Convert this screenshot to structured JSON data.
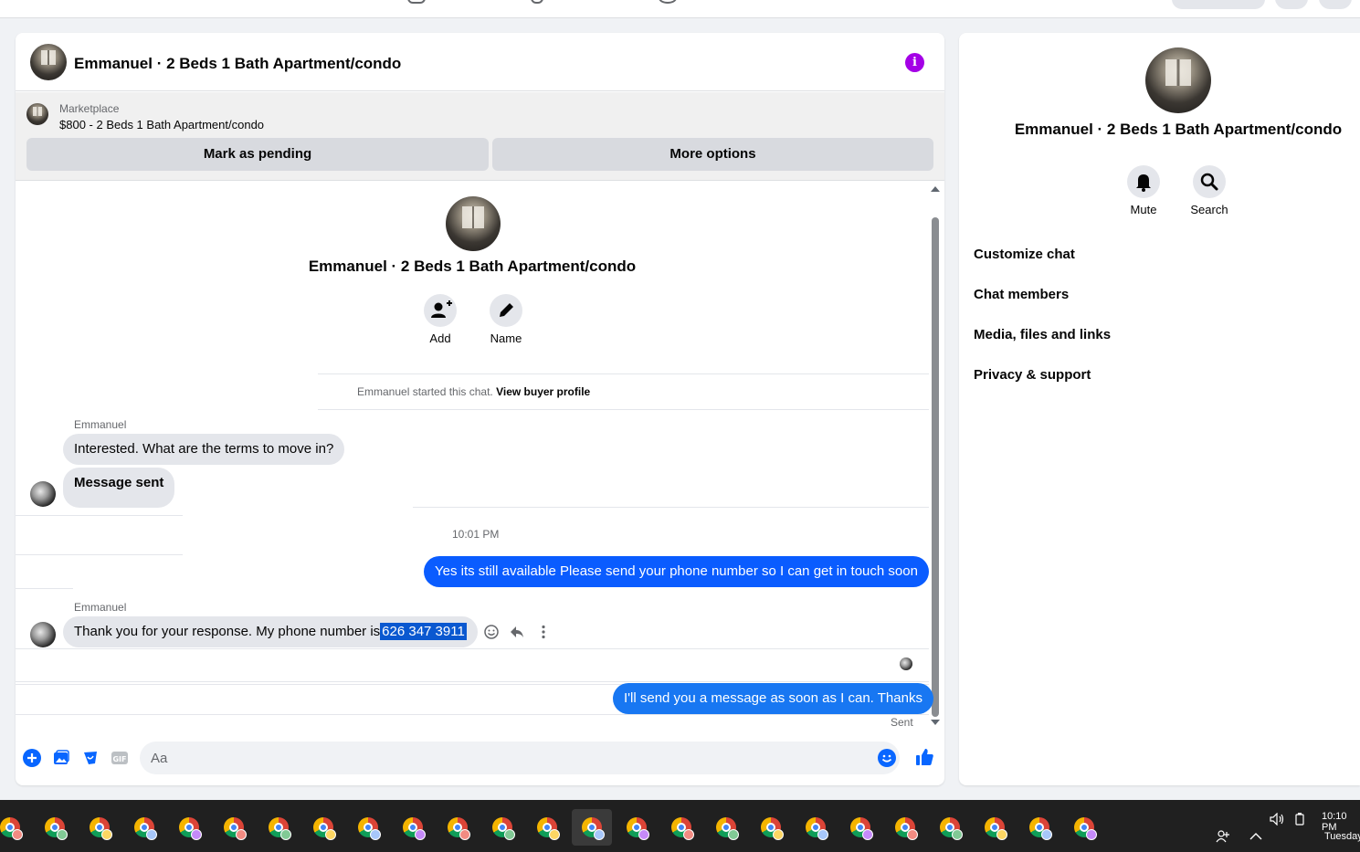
{
  "conversation": {
    "title": "Emmanuel · 2 Beds 1 Bath Apartment/condo"
  },
  "marketplace": {
    "label": "Marketplace",
    "listing": "$800 - 2 Beds 1 Bath Apartment/condo",
    "mark_pending_label": "Mark as pending",
    "more_options_label": "More options"
  },
  "intro": {
    "name": "Emmanuel · 2 Beds 1 Bath Apartment/condo",
    "add_label": "Add",
    "name_label": "Name",
    "started_text": "Emmanuel started this chat.",
    "view_profile_label": "View buyer profile"
  },
  "messages": [
    {
      "sender": "Emmanuel",
      "text": "Interested. What are the terms to move in?"
    },
    {
      "text": "Message sent"
    },
    {
      "timestamp": "10:01 PM"
    },
    {
      "text": "Yes its still available Please send your phone number so I can get in touch soon"
    },
    {
      "sender": "Emmanuel",
      "text_prefix": "Thank you for your response. My phone number is",
      "text_selected": "626 347 3911"
    },
    {
      "text": "I'll send you a message as soon as I can. Thanks",
      "status": "Sent"
    }
  ],
  "composer": {
    "placeholder": "Aa"
  },
  "info_panel": {
    "name": "Emmanuel · 2 Beds 1 Bath Apartment/condo",
    "mute_label": "Mute",
    "search_label": "Search",
    "items": [
      "Customize chat",
      "Chat members",
      "Media, files and links",
      "Privacy & support"
    ]
  },
  "taskbar": {
    "time": "10:10 PM",
    "day": "Tuesday",
    "app_count": 25,
    "active_index": 13
  },
  "colors": {
    "accent_purple": "#a400e6",
    "outgoing_bubble": "#0a5cff",
    "messenger_blue": "#0866ff"
  }
}
